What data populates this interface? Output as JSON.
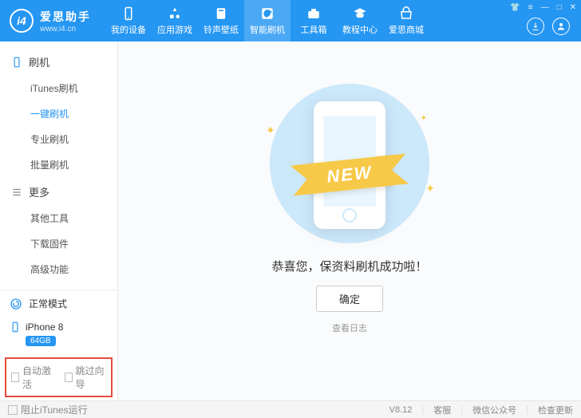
{
  "brand": {
    "logo_label": "i4",
    "name_cn": "爱思助手",
    "url": "www.i4.cn"
  },
  "topnav": [
    {
      "label": "我的设备"
    },
    {
      "label": "应用游戏"
    },
    {
      "label": "铃声壁纸"
    },
    {
      "label": "智能刷机"
    },
    {
      "label": "工具箱"
    },
    {
      "label": "教程中心"
    },
    {
      "label": "爱思商城"
    }
  ],
  "sidebar": {
    "group_flash": "刷机",
    "flash_items": [
      "iTunes刷机",
      "一键刷机",
      "专业刷机",
      "批量刷机"
    ],
    "group_more": "更多",
    "more_items": [
      "其他工具",
      "下载固件",
      "高级功能"
    ]
  },
  "side_bottom": {
    "mode_label": "正常模式",
    "device_name": "iPhone 8",
    "storage_badge": "64GB"
  },
  "highlight": {
    "auto_activate": "自动激活",
    "skip_wizard": "跳过向导"
  },
  "main": {
    "ribbon": "NEW",
    "success_msg": "恭喜您，保资料刷机成功啦！",
    "ok_btn": "确定",
    "view_log": "查看日志"
  },
  "statusbar": {
    "block_itunes": "阻止iTunes运行",
    "version": "V8.12",
    "support": "客服",
    "wechat": "微信公众号",
    "check_update": "检查更新"
  }
}
